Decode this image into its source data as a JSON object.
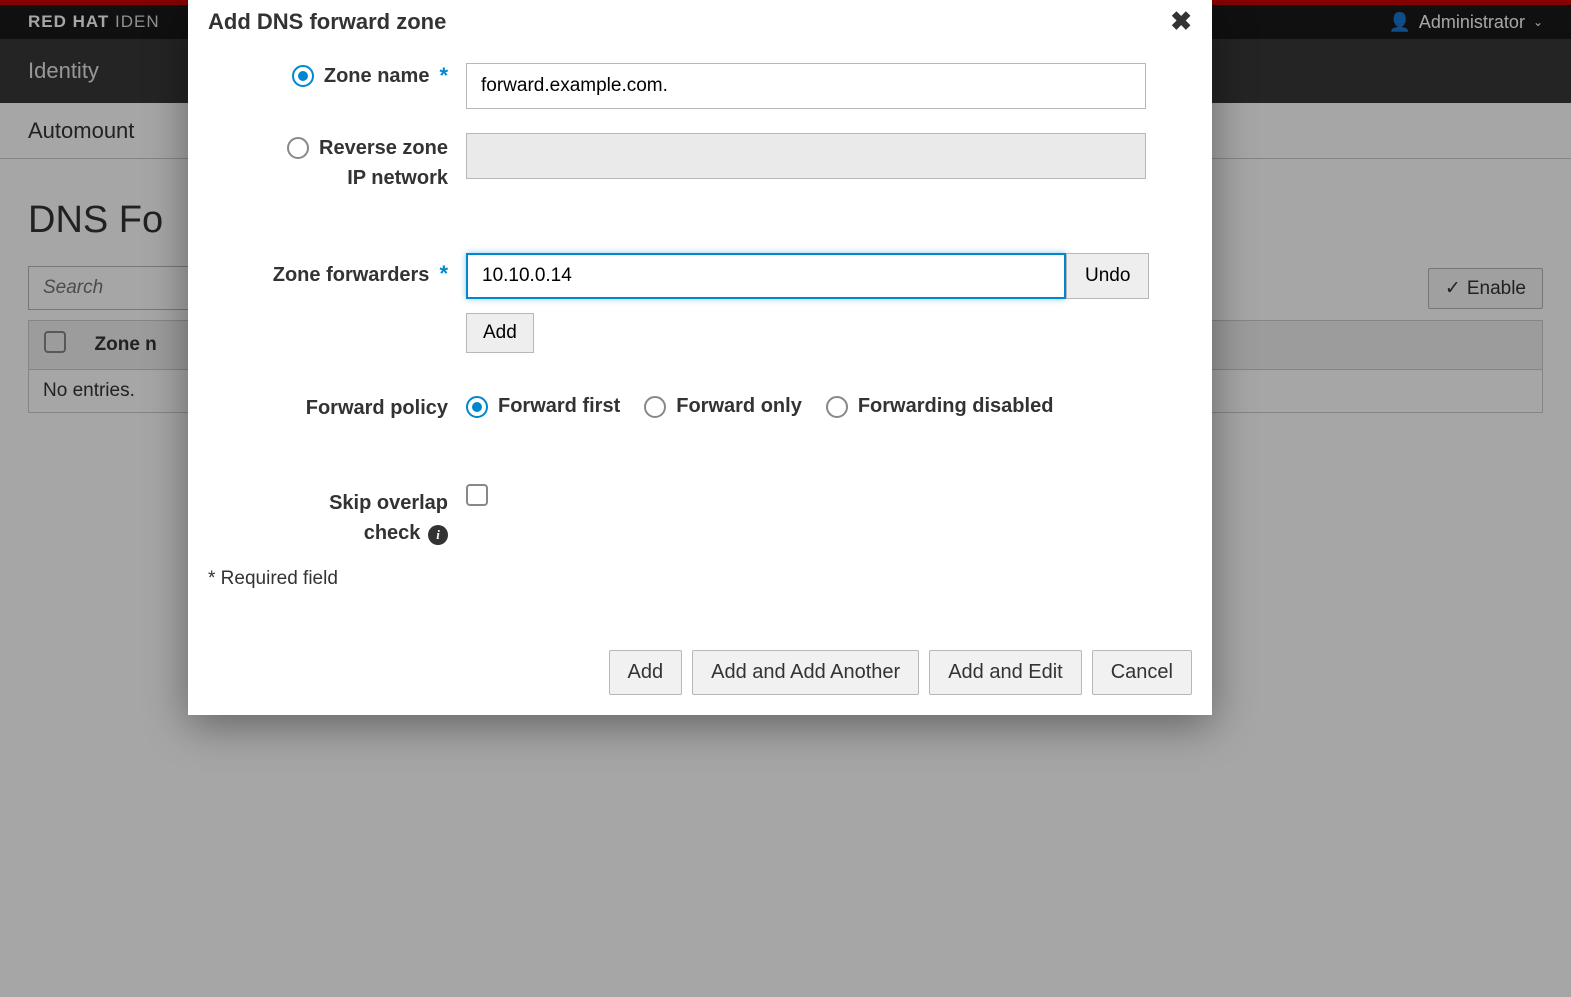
{
  "brand": {
    "strong": "RED HAT",
    "rest": " IDEN"
  },
  "user_menu": {
    "label": "Administrator"
  },
  "main_nav": {
    "item": "Identity"
  },
  "sub_nav": {
    "item": "Automount"
  },
  "page": {
    "title": "DNS Fo",
    "search_placeholder": "Search",
    "enable_btn": "Enable",
    "col_zone": "Zone n",
    "no_entries": "No entries."
  },
  "modal": {
    "title": "Add DNS forward zone",
    "zone_name_label": "Zone name",
    "zone_name_value": "forward.example.com.",
    "reverse_label_l1": "Reverse zone",
    "reverse_label_l2": "IP network",
    "forwarders_label": "Zone forwarders",
    "forwarders_value": "10.10.0.14",
    "undo": "Undo",
    "add_small": "Add",
    "fwd_policy_label": "Forward policy",
    "fwd_first": "Forward first",
    "fwd_only": "Forward only",
    "fwd_disabled": "Forwarding disabled",
    "skip_l1": "Skip overlap",
    "skip_l2": "check",
    "required_note": "* Required field",
    "btn_add": "Add",
    "btn_add_another": "Add and Add Another",
    "btn_add_edit": "Add and Edit",
    "btn_cancel": "Cancel"
  }
}
